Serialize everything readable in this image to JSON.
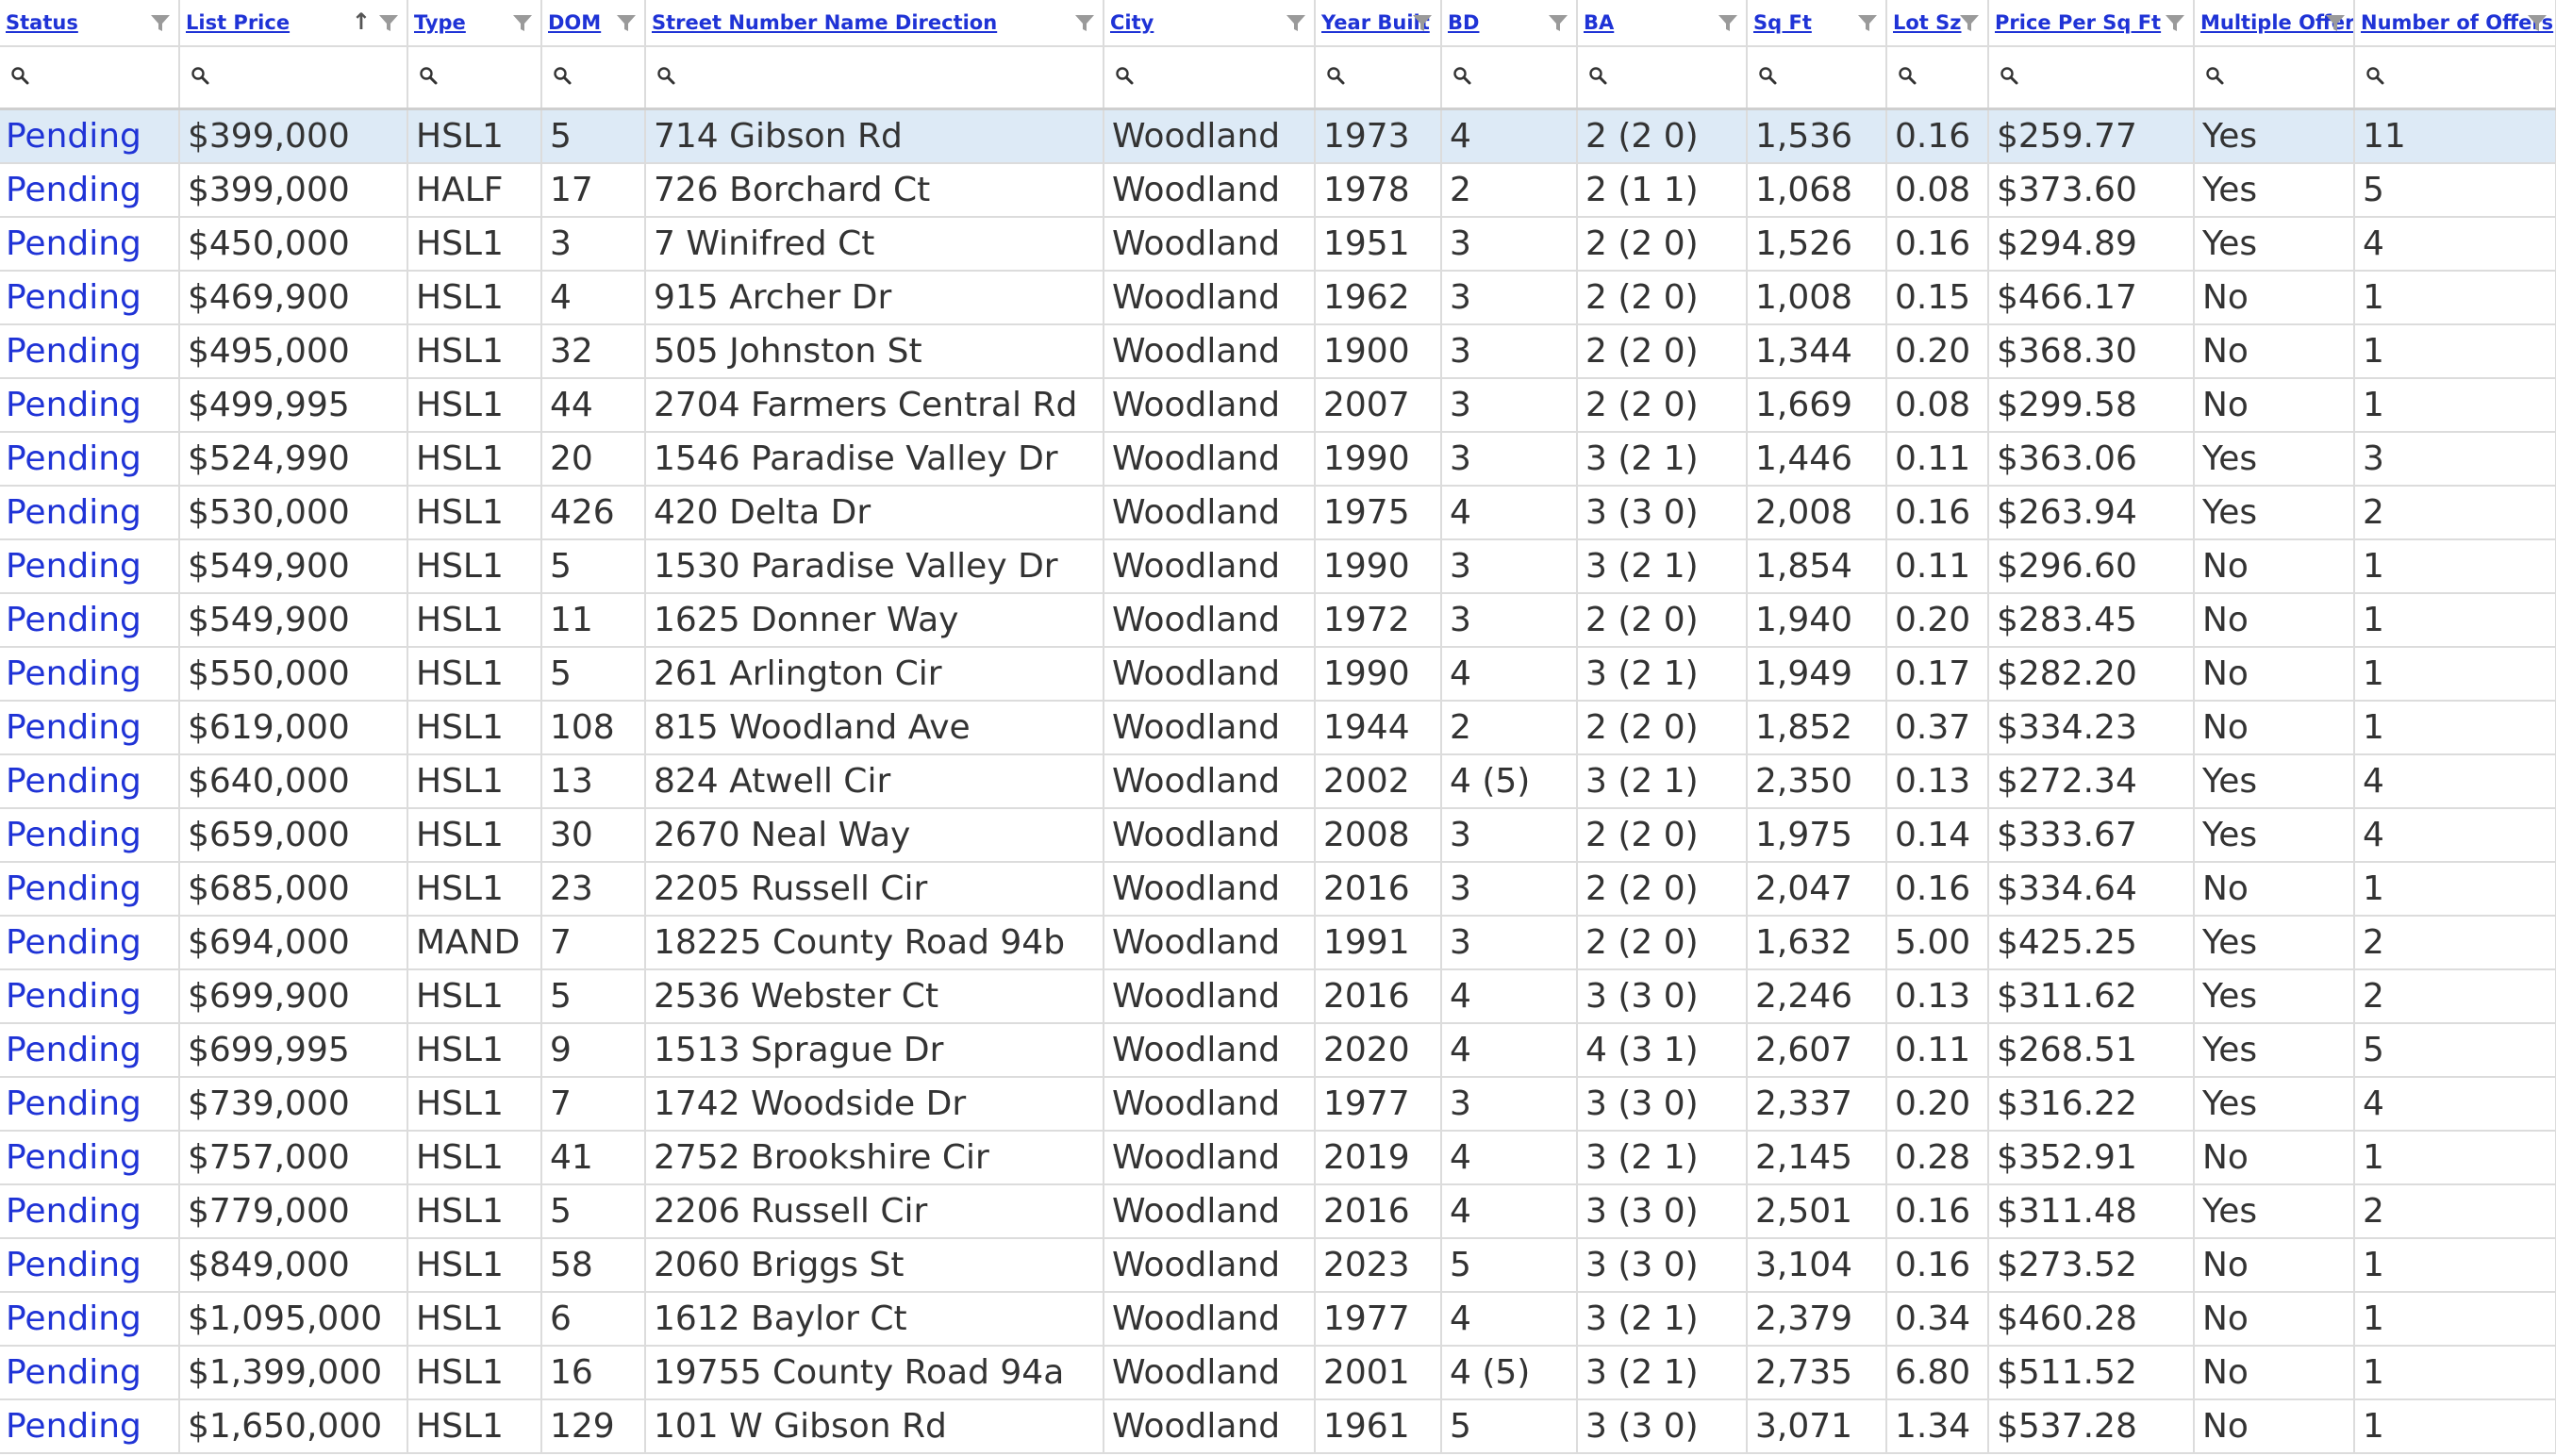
{
  "columns": [
    {
      "key": "status",
      "label": "Status"
    },
    {
      "key": "list_price",
      "label": "List Price",
      "sorted": "asc"
    },
    {
      "key": "type",
      "label": "Type"
    },
    {
      "key": "dom",
      "label": "DOM"
    },
    {
      "key": "address",
      "label": "Street Number Name Direction"
    },
    {
      "key": "city",
      "label": "City"
    },
    {
      "key": "year_built",
      "label": "Year Built"
    },
    {
      "key": "bd",
      "label": "BD"
    },
    {
      "key": "ba",
      "label": "BA"
    },
    {
      "key": "sqft",
      "label": "Sq Ft"
    },
    {
      "key": "lot_sz",
      "label": "Lot Sz"
    },
    {
      "key": "price_per_sqft",
      "label": "Price Per Sq Ft"
    },
    {
      "key": "multiple_offers",
      "label": "Multiple Offers"
    },
    {
      "key": "num_offers",
      "label": "Number of Offers"
    }
  ],
  "sort_arrow": "↑",
  "selected_row": 0,
  "rows": [
    [
      "Pending",
      "$399,000",
      "HSL1",
      "5",
      "714 Gibson Rd",
      "Woodland",
      "1973",
      "4",
      "2 (2 0)",
      "1,536",
      "0.16",
      "$259.77",
      "Yes",
      "11"
    ],
    [
      "Pending",
      "$399,000",
      "HALF",
      "17",
      "726 Borchard Ct",
      "Woodland",
      "1978",
      "2",
      "2 (1 1)",
      "1,068",
      "0.08",
      "$373.60",
      "Yes",
      "5"
    ],
    [
      "Pending",
      "$450,000",
      "HSL1",
      "3",
      "7 Winifred Ct",
      "Woodland",
      "1951",
      "3",
      "2 (2 0)",
      "1,526",
      "0.16",
      "$294.89",
      "Yes",
      "4"
    ],
    [
      "Pending",
      "$469,900",
      "HSL1",
      "4",
      "915 Archer Dr",
      "Woodland",
      "1962",
      "3",
      "2 (2 0)",
      "1,008",
      "0.15",
      "$466.17",
      "No",
      "1"
    ],
    [
      "Pending",
      "$495,000",
      "HSL1",
      "32",
      "505 Johnston St",
      "Woodland",
      "1900",
      "3",
      "2 (2 0)",
      "1,344",
      "0.20",
      "$368.30",
      "No",
      "1"
    ],
    [
      "Pending",
      "$499,995",
      "HSL1",
      "44",
      "2704 Farmers Central Rd",
      "Woodland",
      "2007",
      "3",
      "2 (2 0)",
      "1,669",
      "0.08",
      "$299.58",
      "No",
      "1"
    ],
    [
      "Pending",
      "$524,990",
      "HSL1",
      "20",
      "1546 Paradise Valley Dr",
      "Woodland",
      "1990",
      "3",
      "3 (2 1)",
      "1,446",
      "0.11",
      "$363.06",
      "Yes",
      "3"
    ],
    [
      "Pending",
      "$530,000",
      "HSL1",
      "426",
      "420 Delta Dr",
      "Woodland",
      "1975",
      "4",
      "3 (3 0)",
      "2,008",
      "0.16",
      "$263.94",
      "Yes",
      "2"
    ],
    [
      "Pending",
      "$549,900",
      "HSL1",
      "5",
      "1530 Paradise Valley Dr",
      "Woodland",
      "1990",
      "3",
      "3 (2 1)",
      "1,854",
      "0.11",
      "$296.60",
      "No",
      "1"
    ],
    [
      "Pending",
      "$549,900",
      "HSL1",
      "11",
      "1625 Donner Way",
      "Woodland",
      "1972",
      "3",
      "2 (2 0)",
      "1,940",
      "0.20",
      "$283.45",
      "No",
      "1"
    ],
    [
      "Pending",
      "$550,000",
      "HSL1",
      "5",
      "261 Arlington Cir",
      "Woodland",
      "1990",
      "4",
      "3 (2 1)",
      "1,949",
      "0.17",
      "$282.20",
      "No",
      "1"
    ],
    [
      "Pending",
      "$619,000",
      "HSL1",
      "108",
      "815 Woodland Ave",
      "Woodland",
      "1944",
      "2",
      "2 (2 0)",
      "1,852",
      "0.37",
      "$334.23",
      "No",
      "1"
    ],
    [
      "Pending",
      "$640,000",
      "HSL1",
      "13",
      "824 Atwell Cir",
      "Woodland",
      "2002",
      "4 (5)",
      "3 (2 1)",
      "2,350",
      "0.13",
      "$272.34",
      "Yes",
      "4"
    ],
    [
      "Pending",
      "$659,000",
      "HSL1",
      "30",
      "2670 Neal Way",
      "Woodland",
      "2008",
      "3",
      "2 (2 0)",
      "1,975",
      "0.14",
      "$333.67",
      "Yes",
      "4"
    ],
    [
      "Pending",
      "$685,000",
      "HSL1",
      "23",
      "2205 Russell Cir",
      "Woodland",
      "2016",
      "3",
      "2 (2 0)",
      "2,047",
      "0.16",
      "$334.64",
      "No",
      "1"
    ],
    [
      "Pending",
      "$694,000",
      "MAND",
      "7",
      "18225 County Road 94b",
      "Woodland",
      "1991",
      "3",
      "2 (2 0)",
      "1,632",
      "5.00",
      "$425.25",
      "Yes",
      "2"
    ],
    [
      "Pending",
      "$699,900",
      "HSL1",
      "5",
      "2536 Webster Ct",
      "Woodland",
      "2016",
      "4",
      "3 (3 0)",
      "2,246",
      "0.13",
      "$311.62",
      "Yes",
      "2"
    ],
    [
      "Pending",
      "$699,995",
      "HSL1",
      "9",
      "1513 Sprague Dr",
      "Woodland",
      "2020",
      "4",
      "4 (3 1)",
      "2,607",
      "0.11",
      "$268.51",
      "Yes",
      "5"
    ],
    [
      "Pending",
      "$739,000",
      "HSL1",
      "7",
      "1742 Woodside Dr",
      "Woodland",
      "1977",
      "3",
      "3 (3 0)",
      "2,337",
      "0.20",
      "$316.22",
      "Yes",
      "4"
    ],
    [
      "Pending",
      "$757,000",
      "HSL1",
      "41",
      "2752 Brookshire Cir",
      "Woodland",
      "2019",
      "4",
      "3 (2 1)",
      "2,145",
      "0.28",
      "$352.91",
      "No",
      "1"
    ],
    [
      "Pending",
      "$779,000",
      "HSL1",
      "5",
      "2206 Russell Cir",
      "Woodland",
      "2016",
      "4",
      "3 (3 0)",
      "2,501",
      "0.16",
      "$311.48",
      "Yes",
      "2"
    ],
    [
      "Pending",
      "$849,000",
      "HSL1",
      "58",
      "2060 Briggs St",
      "Woodland",
      "2023",
      "5",
      "3 (3 0)",
      "3,104",
      "0.16",
      "$273.52",
      "No",
      "1"
    ],
    [
      "Pending",
      "$1,095,000",
      "HSL1",
      "6",
      "1612 Baylor Ct",
      "Woodland",
      "1977",
      "4",
      "3 (2 1)",
      "2,379",
      "0.34",
      "$460.28",
      "No",
      "1"
    ],
    [
      "Pending",
      "$1,399,000",
      "HSL1",
      "16",
      "19755 County Road 94a",
      "Woodland",
      "2001",
      "4 (5)",
      "3 (2 1)",
      "2,735",
      "6.80",
      "$511.52",
      "No",
      "1"
    ],
    [
      "Pending",
      "$1,650,000",
      "HSL1",
      "129",
      "101 W Gibson Rd",
      "Woodland",
      "1961",
      "5",
      "3 (3 0)",
      "3,071",
      "1.34",
      "$537.28",
      "No",
      "1"
    ]
  ]
}
